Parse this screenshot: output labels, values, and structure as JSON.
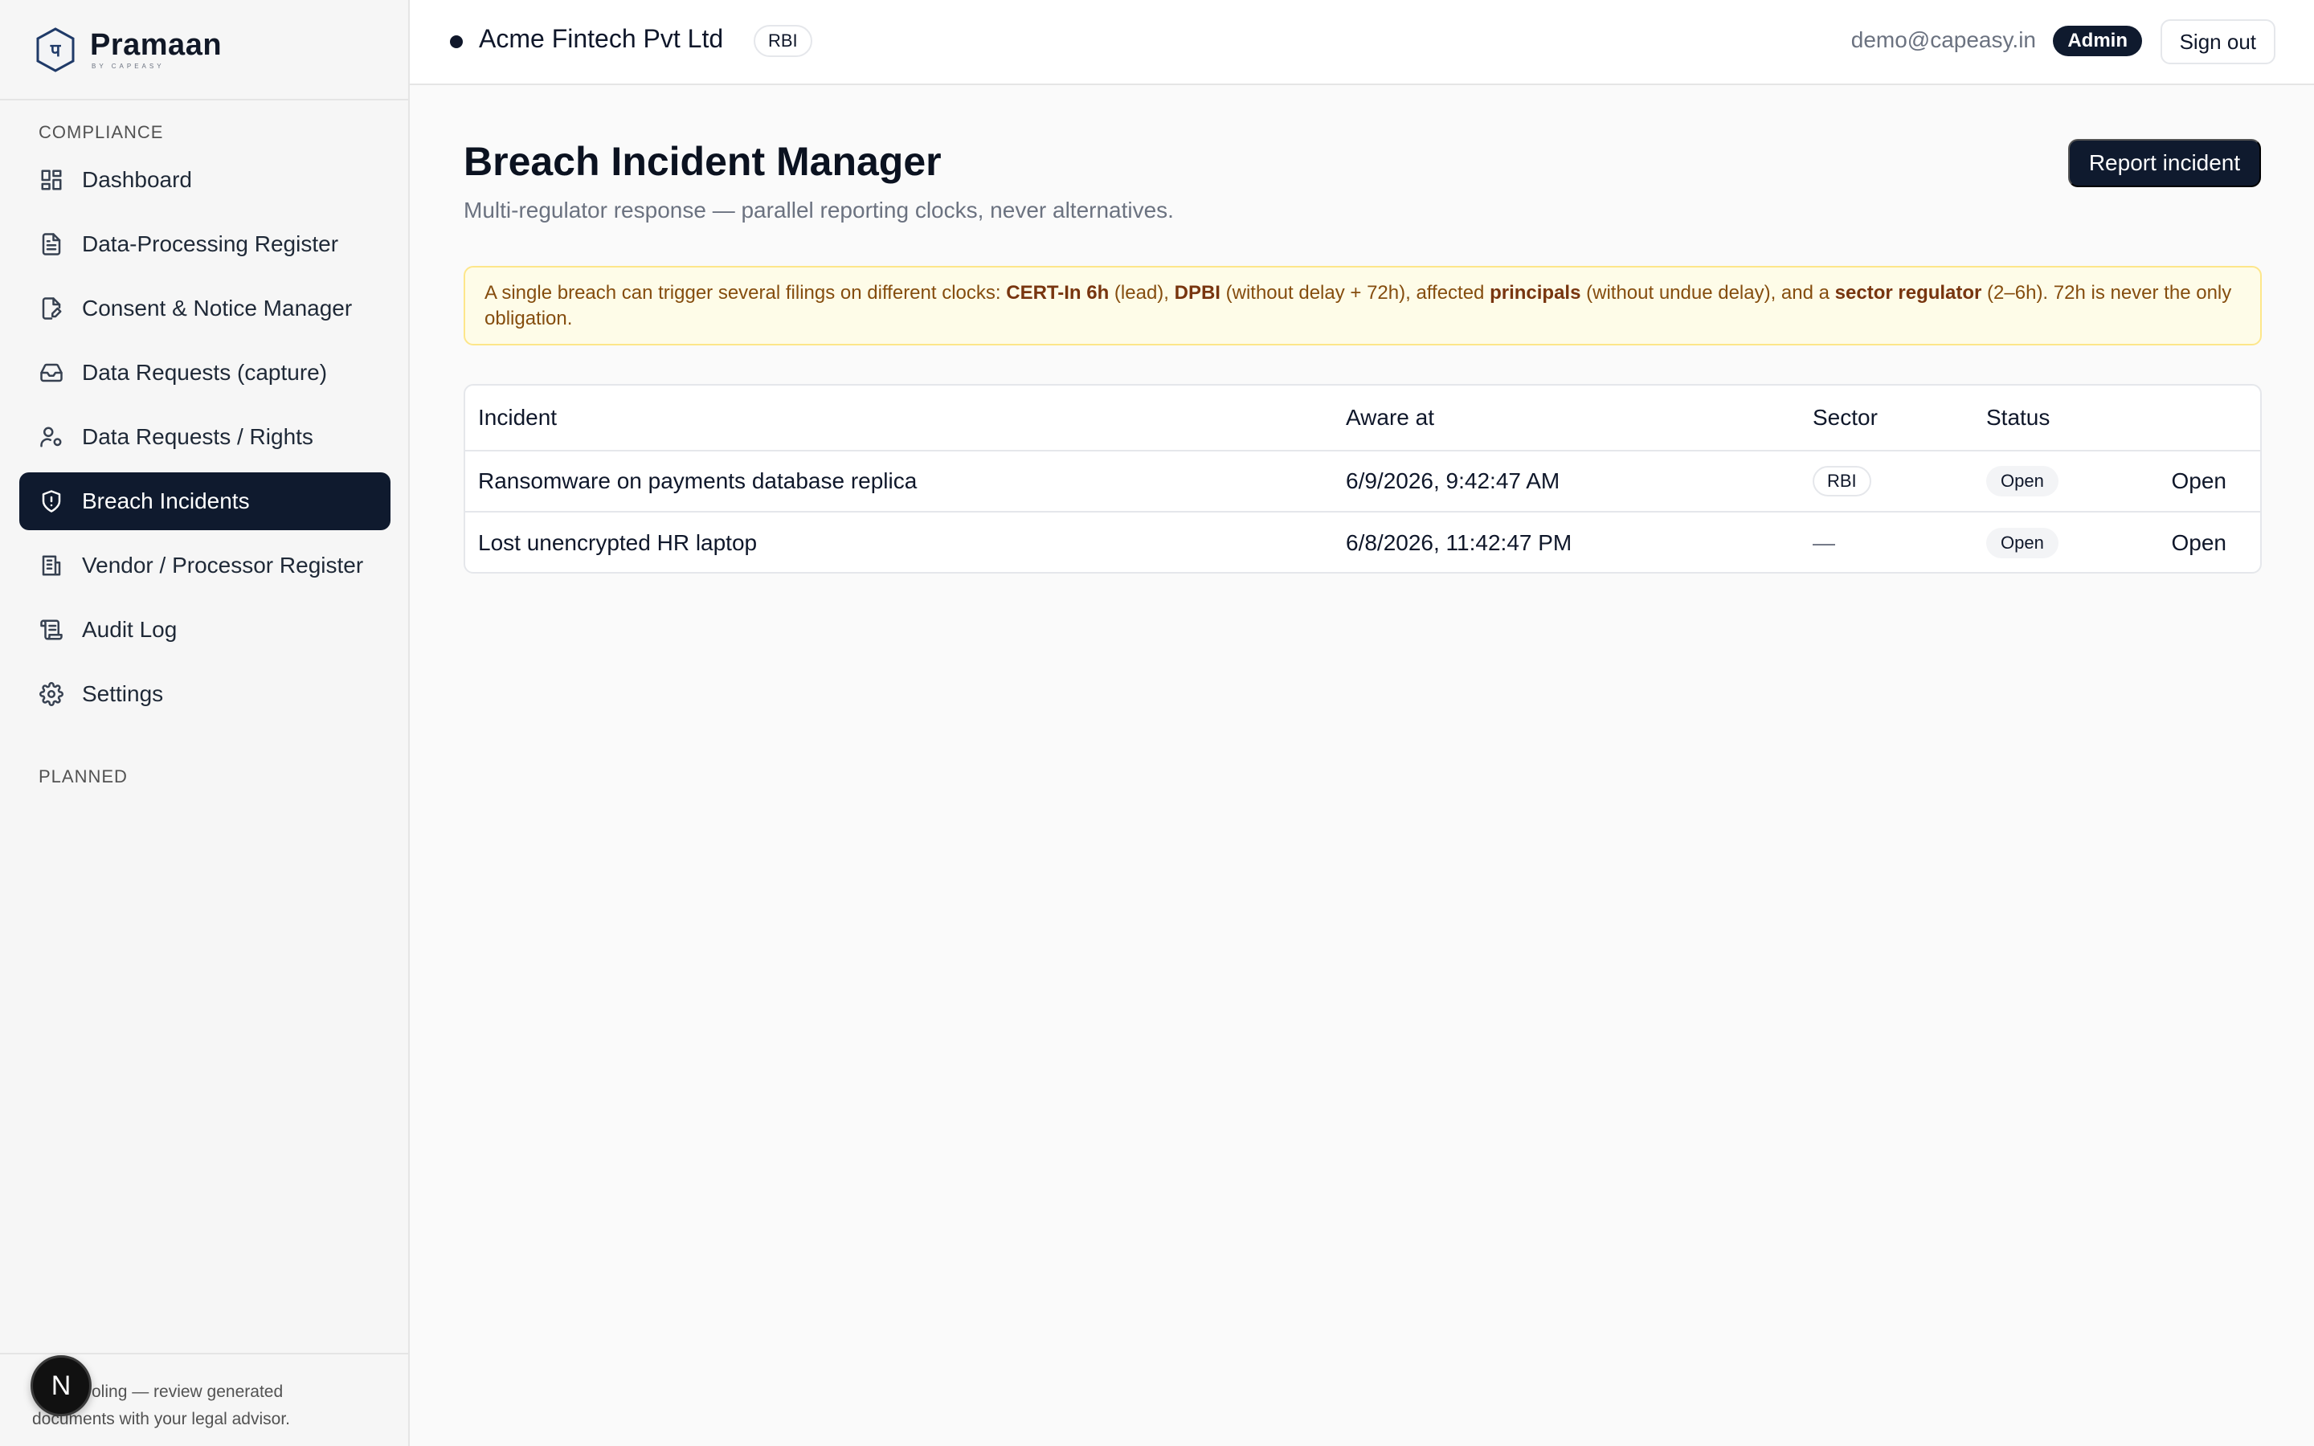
{
  "brand": {
    "name": "Pramaan",
    "tagline": "BY CAPEASY"
  },
  "sidebar": {
    "section_compliance": "COMPLIANCE",
    "items": [
      {
        "label": "Dashboard",
        "icon": "dashboard-icon",
        "active": false
      },
      {
        "label": "Data-Processing Register",
        "icon": "document-icon",
        "active": false
      },
      {
        "label": "Consent & Notice Manager",
        "icon": "edit-document-icon",
        "active": false
      },
      {
        "label": "Data Requests (capture)",
        "icon": "inbox-icon",
        "active": false
      },
      {
        "label": "Data Requests / Rights",
        "icon": "user-settings-icon",
        "active": false
      },
      {
        "label": "Breach Incidents",
        "icon": "shield-alert-icon",
        "active": true
      },
      {
        "label": "Vendor / Processor Register",
        "icon": "building-icon",
        "active": false
      },
      {
        "label": "Audit Log",
        "icon": "scroll-icon",
        "active": false
      },
      {
        "label": "Settings",
        "icon": "gear-icon",
        "active": false
      }
    ],
    "section_planned": "PLANNED",
    "footer_line1": "oling — review generated",
    "footer_line2": "documents with your legal advisor.",
    "avatar_letter": "N"
  },
  "header": {
    "org_name": "Acme Fintech Pvt Ltd",
    "org_badge": "RBI",
    "user_email": "demo@capeasy.in",
    "role": "Admin",
    "signout_label": "Sign out"
  },
  "main": {
    "title": "Breach Incident Manager",
    "subtitle": "Multi-regulator response — parallel reporting clocks, never alternatives.",
    "report_button": "Report incident",
    "notice": {
      "t1": "A single breach can trigger several filings on different clocks: ",
      "b1": "CERT-In 6h",
      "t2": " (lead), ",
      "b2": "DPBI",
      "t3": " (without delay + 72h), affected ",
      "b3": "principals",
      "t4": " (without undue delay), and a ",
      "b4": "sector regulator",
      "t5": " (2–6h). 72h is never the only obligation."
    },
    "table": {
      "headers": [
        "Incident",
        "Aware at",
        "Sector",
        "Status"
      ],
      "rows": [
        {
          "incident": "Ransomware on payments database replica",
          "aware_at": "6/9/2026, 9:42:47 AM",
          "sector": "RBI",
          "status": "Open",
          "action": "Open"
        },
        {
          "incident": "Lost unencrypted HR laptop",
          "aware_at": "6/8/2026, 11:42:47 PM",
          "sector": "—",
          "status": "Open",
          "action": "Open"
        }
      ]
    }
  }
}
